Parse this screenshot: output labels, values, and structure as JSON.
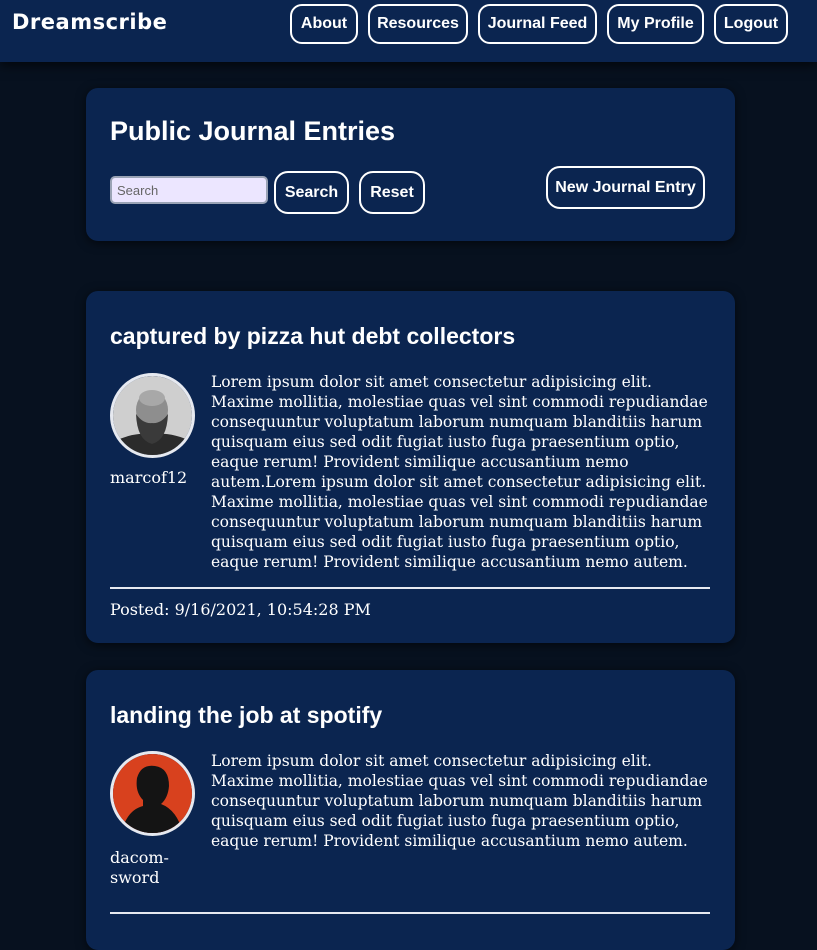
{
  "nav": {
    "brand": "Dreamscribe",
    "links": [
      {
        "label": "About"
      },
      {
        "label": "Resources"
      },
      {
        "label": "Journal Feed"
      },
      {
        "label": "My Profile"
      },
      {
        "label": "Logout"
      }
    ]
  },
  "header": {
    "title": "Public Journal Entries",
    "search_placeholder": "Search",
    "search_value": "",
    "search_button": "Search",
    "reset_button": "Reset",
    "new_entry_button": "New Journal Entry"
  },
  "entries": [
    {
      "title": "captured by pizza hut debt collectors",
      "author": "marcof12",
      "avatar_icon": "bald-bearded-man-avatar",
      "body": "Lorem ipsum dolor sit amet consectetur adipisicing elit. Maxime mollitia, molestiae quas vel sint commodi repudiandae consequuntur voluptatum laborum numquam blanditiis harum quisquam eius sed odit fugiat iusto fuga praesentium optio, eaque rerum! Provident similique accusantium nemo autem.Lorem ipsum dolor sit amet consectetur adipisicing elit. Maxime mollitia, molestiae quas vel sint commodi repudiandae consequuntur voluptatum laborum numquam blanditiis harum quisquam eius sed odit fugiat iusto fuga praesentium optio, eaque rerum! Provident similique accusantium nemo autem.",
      "posted": "Posted: 9/16/2021, 10:54:28 PM"
    },
    {
      "title": "landing the job at spotify",
      "author": "dacom-sword",
      "avatar_icon": "silhouette-red-background-avatar",
      "body": "Lorem ipsum dolor sit amet consectetur adipisicing elit. Maxime mollitia, molestiae quas vel sint commodi repudiandae consequuntur voluptatum laborum numquam blanditiis harum quisquam eius sed odit fugiat iusto fuga praesentium optio, eaque rerum! Provident similique accusantium nemo autem."
    }
  ],
  "colors": {
    "page_background": "#07111f",
    "card_background": "#0b2550",
    "button_border": "#ffffff",
    "search_background": "#ece6ff"
  }
}
